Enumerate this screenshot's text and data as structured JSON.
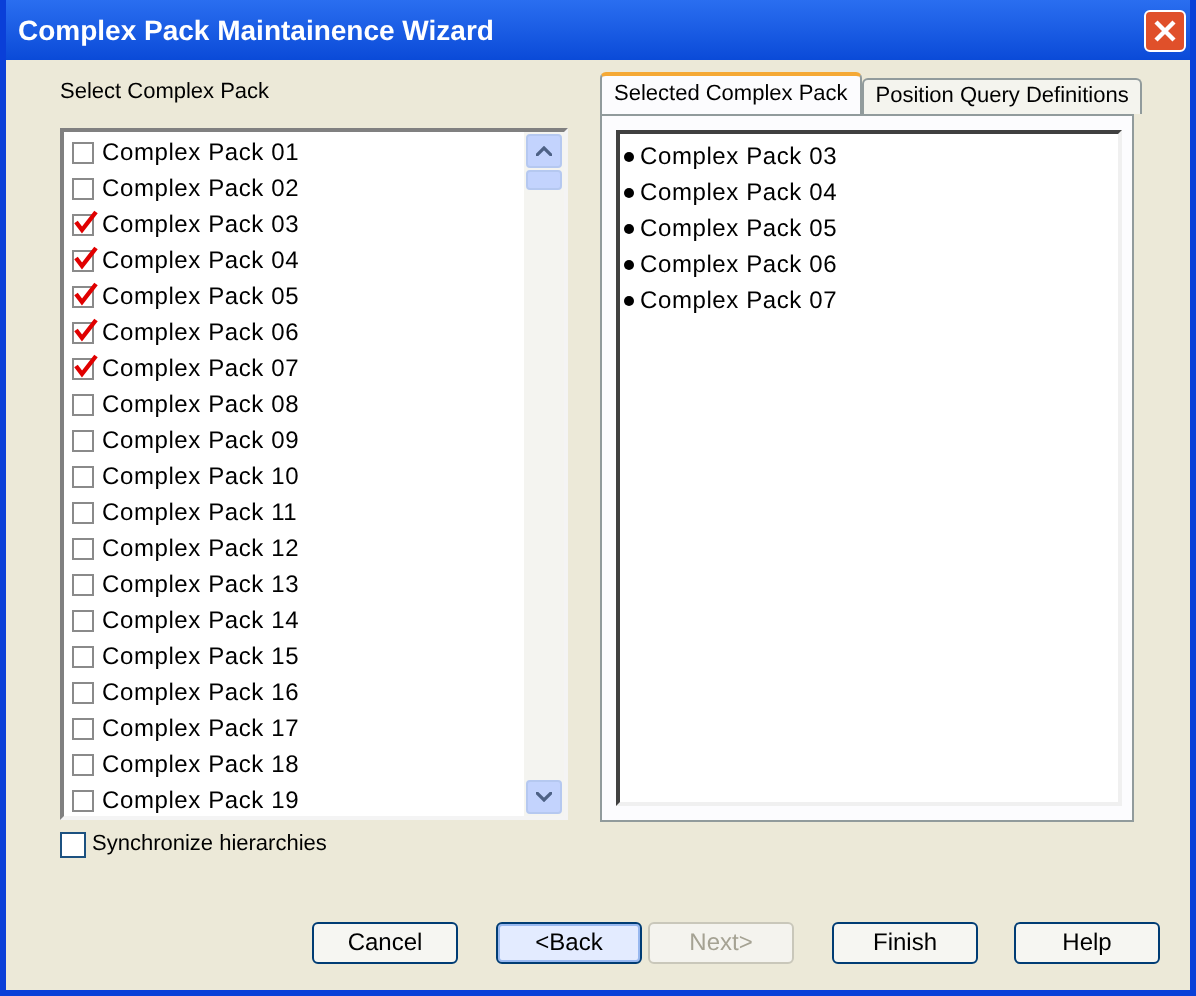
{
  "window": {
    "title": "Complex Pack Maintainence Wizard"
  },
  "left": {
    "label": "Select Complex Pack",
    "items": [
      {
        "label": "Complex Pack 01",
        "checked": false
      },
      {
        "label": "Complex Pack 02",
        "checked": false
      },
      {
        "label": "Complex Pack 03",
        "checked": true
      },
      {
        "label": "Complex Pack 04",
        "checked": true
      },
      {
        "label": "Complex Pack 05",
        "checked": true
      },
      {
        "label": "Complex Pack 06",
        "checked": true
      },
      {
        "label": "Complex Pack 07",
        "checked": true
      },
      {
        "label": "Complex Pack 08",
        "checked": false
      },
      {
        "label": "Complex Pack 09",
        "checked": false
      },
      {
        "label": "Complex Pack 10",
        "checked": false
      },
      {
        "label": "Complex Pack 11",
        "checked": false
      },
      {
        "label": "Complex Pack 12",
        "checked": false
      },
      {
        "label": "Complex Pack 13",
        "checked": false
      },
      {
        "label": "Complex Pack 14",
        "checked": false
      },
      {
        "label": "Complex Pack 15",
        "checked": false
      },
      {
        "label": "Complex Pack 16",
        "checked": false
      },
      {
        "label": "Complex Pack 17",
        "checked": false
      },
      {
        "label": "Complex Pack 18",
        "checked": false
      },
      {
        "label": "Complex Pack 19",
        "checked": false
      }
    ],
    "sync": {
      "label": "Synchronize hierarchies",
      "checked": false
    }
  },
  "tabs": [
    {
      "label": "Selected Complex Pack",
      "selected": true
    },
    {
      "label": "Position Query Definitions",
      "selected": false
    }
  ],
  "selected_items": [
    "Complex Pack 03",
    "Complex Pack 04",
    "Complex Pack 05",
    "Complex Pack 06",
    "Complex Pack 07"
  ],
  "buttons": [
    {
      "label": "Cancel",
      "disabled": false,
      "focused": false
    },
    {
      "label": "<Back",
      "disabled": false,
      "focused": true
    },
    {
      "label": "Next>",
      "disabled": true,
      "focused": false
    },
    {
      "label": "Finish",
      "disabled": false,
      "focused": false
    },
    {
      "label": "Help",
      "disabled": false,
      "focused": false
    }
  ]
}
